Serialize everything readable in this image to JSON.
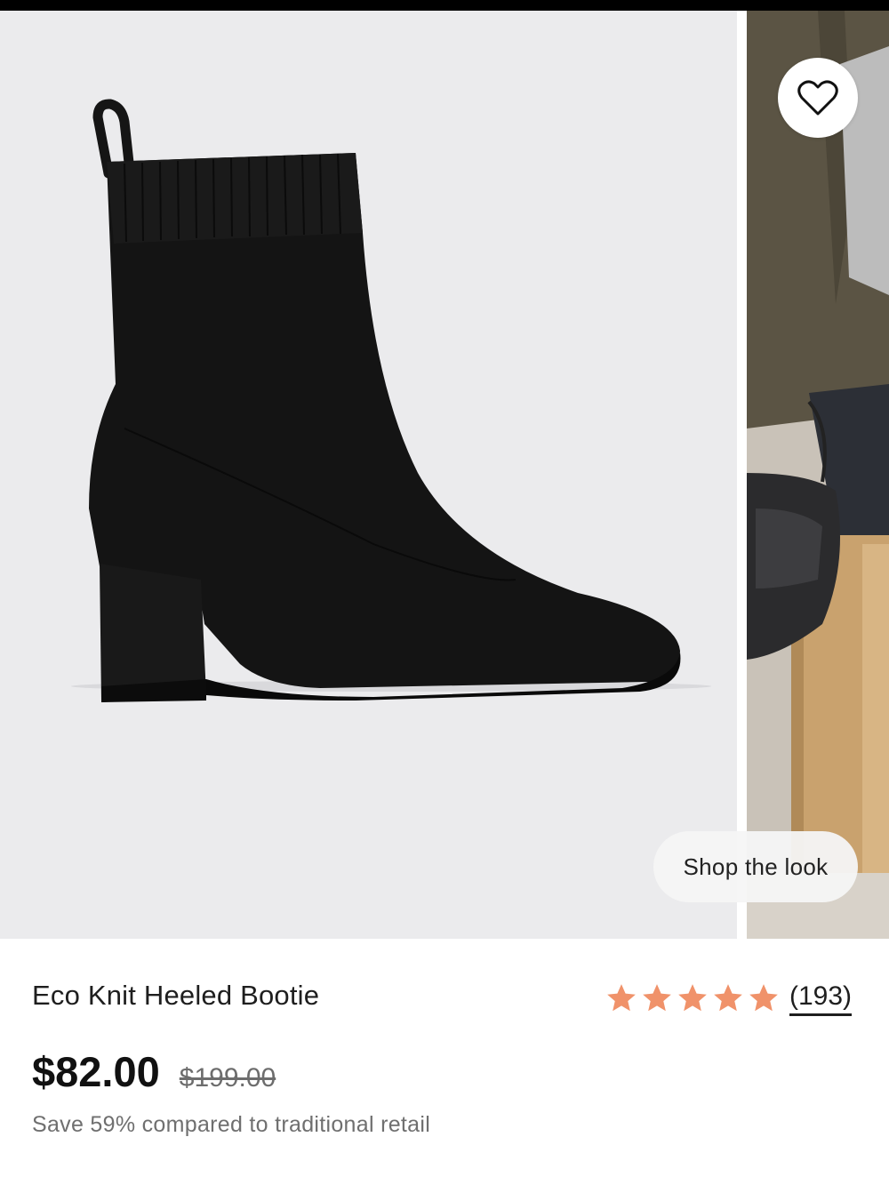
{
  "gallery": {
    "favorite_icon": "heart-outline-icon",
    "shop_the_look_label": "Shop the look"
  },
  "product": {
    "title": "Eco Knit Heeled Bootie",
    "rating": {
      "stars": 5,
      "max_stars": 5,
      "review_count": "(193)",
      "star_color": "#f0926a"
    },
    "price": "$82.00",
    "original_price": "$199.00",
    "savings_text": "Save 59% compared to traditional retail"
  },
  "colors": {
    "image_background": "#ebebed",
    "boot": "#121212",
    "star": "#f0926a"
  }
}
